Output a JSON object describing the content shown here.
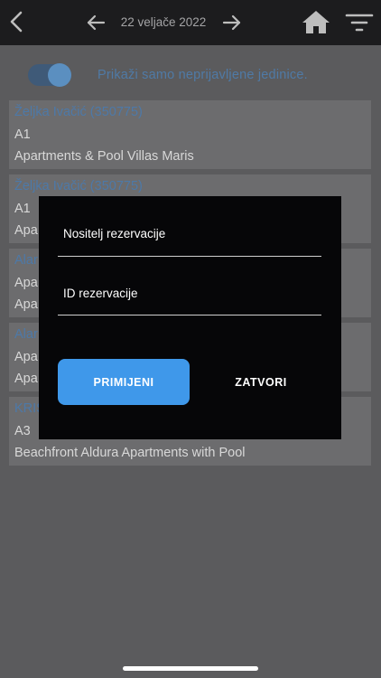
{
  "header": {
    "date": "22 veljače 2022",
    "icons": [
      "back-icon",
      "arrow-left-icon",
      "arrow-right-icon",
      "home-icon",
      "filter-icon"
    ]
  },
  "toggle": {
    "label": "Prikaži samo neprijavljene jedinice.",
    "on": true
  },
  "cards": [
    {
      "name": "Željka Ivačić (350775)",
      "unit": "A1",
      "property": "Apartments & Pool Villas Maris"
    },
    {
      "name": "Željka Ivačić (350775)",
      "unit": "A1",
      "property": "Apa"
    },
    {
      "name": "Alar",
      "unit": "Apa",
      "property": "Apa"
    },
    {
      "name": "Alar",
      "unit": "Apa",
      "property": "Apa"
    },
    {
      "name": "KRIS",
      "unit": "A3",
      "property": "Beachfront Aldura Apartments with Pool"
    }
  ],
  "dialog": {
    "holder_placeholder": "Nositelj rezervacije",
    "id_placeholder": "ID rezervacije",
    "apply_label": "PRIMIJENI",
    "close_label": "ZATVORI"
  },
  "colors": {
    "accent": "#3f98ea",
    "link": "#4d79a8",
    "background": "#5b5b5d",
    "dialog": "#060608"
  }
}
